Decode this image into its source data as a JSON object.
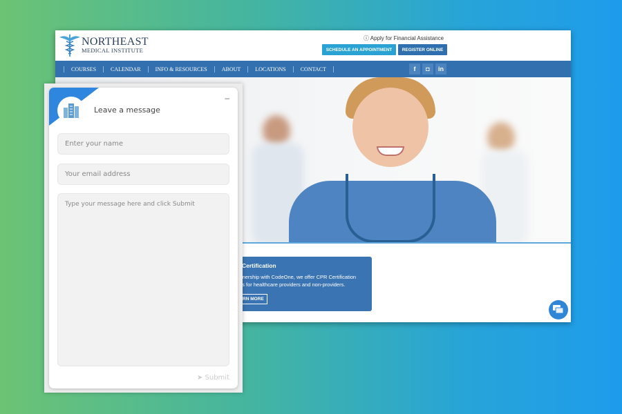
{
  "site": {
    "logo": {
      "line1": "NORTHEAST",
      "line2": "MEDICAL INSTITUTE"
    },
    "financial_link": "Apply for Financial Assistance",
    "schedule_button": "SCHEDULE AN APPOINTMENT",
    "register_button": "REGISTER ONLINE",
    "nav": [
      "COURSES",
      "CALENDAR",
      "INFO & RESOURCES",
      "ABOUT",
      "LOCATIONS",
      "CONTACT"
    ],
    "social": [
      "f",
      "ig",
      "in"
    ],
    "card": {
      "title": "Certification",
      "text1": "rtnership with CodeOne, we offer CPR Certification",
      "text2": "es for healthcare providers and non-providers.",
      "button": "RN MORE"
    }
  },
  "widget": {
    "title": "Leave a message",
    "minimize": "–",
    "name_placeholder": "Enter your name",
    "email_placeholder": "Your email address",
    "message_placeholder": "Type your message here and click Submit",
    "submit": "Submit"
  },
  "colors": {
    "nav": "#3270b0",
    "accent": "#2f86de",
    "schedule": "#2aa3d4",
    "register": "#2f6fb0"
  }
}
